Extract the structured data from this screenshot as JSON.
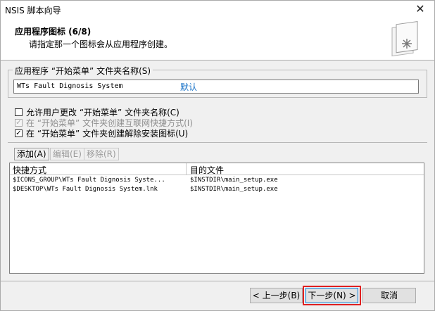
{
  "window": {
    "title": "NSIS 脚本向导",
    "close_glyph": "✕"
  },
  "header": {
    "heading": "应用程序图标 (6/8)",
    "subtitle": "请指定那一个图标会从应用程序创建。",
    "logo_icon": "wizard-book-icon"
  },
  "folder": {
    "group_label": "应用程序 “开始菜单” 文件夹名称(S)",
    "value": "WTs Fault Dignosis System",
    "default_link": "默认"
  },
  "options": [
    {
      "label": "允许用户更改 “开始菜单” 文件夹名称(C)",
      "checked": false,
      "enabled": true
    },
    {
      "label": "在 “开始菜单” 文件夹创建互联网快捷方式(I)",
      "checked": true,
      "enabled": false
    },
    {
      "label": "在 “开始菜单” 文件夹创建解除安装图标(U)",
      "checked": true,
      "enabled": true
    }
  ],
  "toolbar": {
    "add_label": "添加(A)",
    "edit_label": "编辑(E)",
    "remove_label": "移除(R)"
  },
  "shortcuts": {
    "columns": [
      "快捷方式",
      "目的文件"
    ],
    "rows": [
      [
        "$ICONS_GROUP\\WTs Fault Dignosis Syste...",
        "$INSTDIR\\main_setup.exe"
      ],
      [
        "$DESKTOP\\WTs Fault Dignosis System.lnk",
        "$INSTDIR\\main_setup.exe"
      ]
    ]
  },
  "nav": {
    "back_label": "< 上一步(B)",
    "next_label": "下一步(N) >",
    "cancel_label": "取消"
  },
  "colors": {
    "link": "#1a73c8",
    "highlight": "#e02020",
    "focus": "#0078d7"
  }
}
